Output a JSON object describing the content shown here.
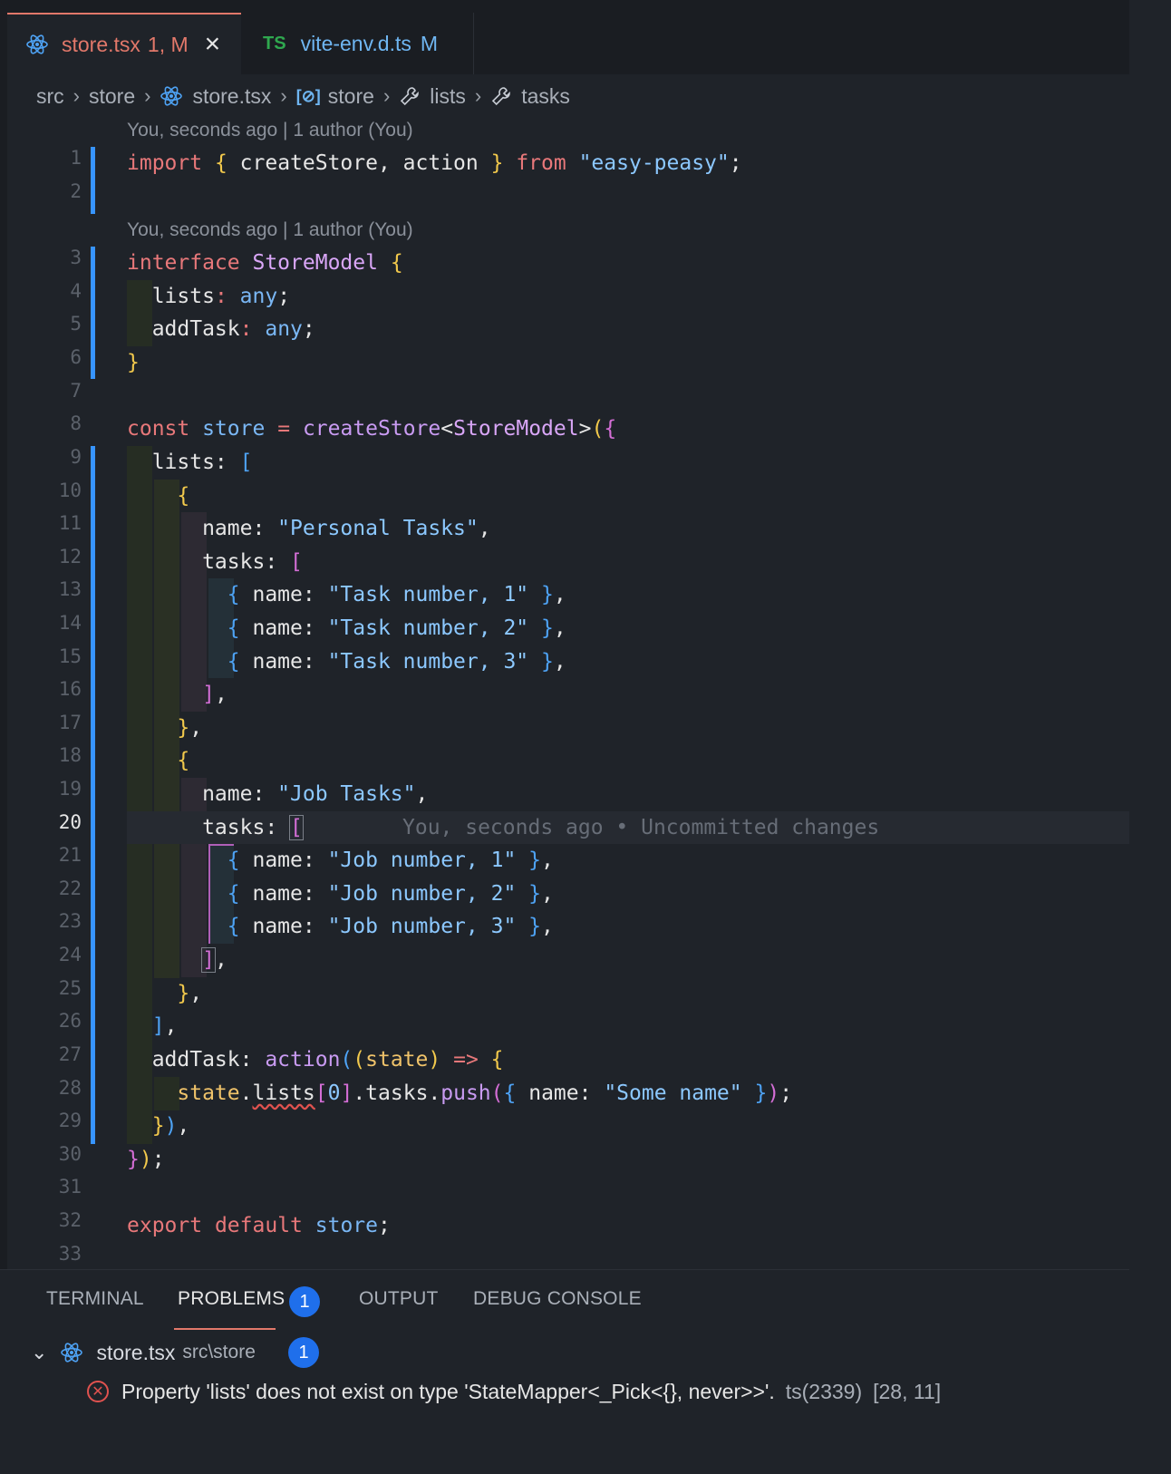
{
  "tabs": [
    {
      "name": "store.tsx",
      "badge": "1, M",
      "icon": "react-icon"
    },
    {
      "name": "vite-env.d.ts",
      "badge": "M",
      "icon": "ts-icon",
      "icon_text": "TS"
    }
  ],
  "breadcrumb": {
    "src": "src",
    "store_folder": "store",
    "file": "store.tsx",
    "store_var": "store",
    "lists": "lists",
    "tasks": "tasks"
  },
  "blame": [
    "You, seconds ago | 1 author (You)",
    "You, seconds ago | 1 author (You)"
  ],
  "line_numbers": [
    "1",
    "2",
    "3",
    "4",
    "5",
    "6",
    "7",
    "8",
    "9",
    "10",
    "11",
    "12",
    "13",
    "14",
    "15",
    "16",
    "17",
    "18",
    "19",
    "20",
    "21",
    "22",
    "23",
    "24",
    "25",
    "26",
    "27",
    "28",
    "29",
    "30",
    "31",
    "32",
    "33"
  ],
  "ghost_text": "You, seconds ago • Uncommitted changes",
  "panel": {
    "tabs": [
      "TERMINAL",
      "PROBLEMS",
      "OUTPUT",
      "DEBUG CONSOLE"
    ],
    "problems_count": "1",
    "file": "store.tsx",
    "file_path": "src\\store",
    "file_count": "1",
    "error_message": "Property 'lists' does not exist on type 'StateMapper<_Pick<{}, never>>'.",
    "error_code": "ts(2339)",
    "error_pos": "[28, 11]"
  },
  "colors": {
    "accent": "#e2786a",
    "modified_blue": "#3794ff",
    "error": "#e0524f",
    "badge": "#1f6feb"
  }
}
